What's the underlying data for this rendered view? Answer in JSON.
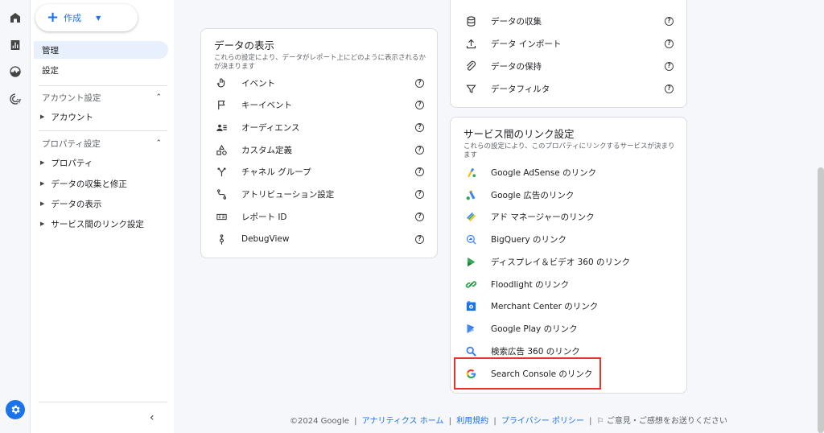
{
  "nav": {
    "create_label": "作成",
    "items": [
      {
        "label": "管理",
        "active": true
      },
      {
        "label": "設定",
        "active": false
      }
    ],
    "account_section": "アカウント設定",
    "account_items": [
      "アカウント"
    ],
    "property_section": "プロパティ設定",
    "property_items": [
      "プロパティ",
      "データの収集と修正",
      "データの表示",
      "サービス間のリンク設定"
    ]
  },
  "data_display": {
    "title": "データの表示",
    "description": "これらの設定により、データがレポート上にどのように表示されるかが決まります",
    "rows": [
      {
        "label": "イベント",
        "icon": "touch-icon"
      },
      {
        "label": "キーイベント",
        "icon": "flag-icon"
      },
      {
        "label": "オーディエンス",
        "icon": "audience-icon"
      },
      {
        "label": "カスタム定義",
        "icon": "shapes-icon"
      },
      {
        "label": "チャネル グループ",
        "icon": "merge-icon"
      },
      {
        "label": "アトリビューション設定",
        "icon": "route-icon"
      },
      {
        "label": "レポート ID",
        "icon": "report-id-icon"
      },
      {
        "label": "DebugView",
        "icon": "debug-icon"
      }
    ]
  },
  "data_collection": {
    "rows": [
      {
        "label": "データの収集",
        "icon": "database-icon"
      },
      {
        "label": "データ インポート",
        "icon": "upload-icon"
      },
      {
        "label": "データの保持",
        "icon": "retention-icon"
      },
      {
        "label": "データフィルタ",
        "icon": "filter-icon"
      }
    ]
  },
  "links": {
    "title": "サービス間のリンク設定",
    "description": "これらの設定により、このプロパティにリンクするサービスが決まります",
    "rows": [
      {
        "label": "Google AdSense のリンク",
        "icon": "adsense-icon"
      },
      {
        "label": "Google 広告のリンク",
        "icon": "google-ads-icon"
      },
      {
        "label": "アド マネージャーのリンク",
        "icon": "ad-manager-icon"
      },
      {
        "label": "BigQuery のリンク",
        "icon": "bigquery-icon"
      },
      {
        "label": "ディスプレイ＆ビデオ 360 のリンク",
        "icon": "dv360-icon"
      },
      {
        "label": "Floodlight のリンク",
        "icon": "floodlight-icon"
      },
      {
        "label": "Merchant Center のリンク",
        "icon": "merchant-center-icon"
      },
      {
        "label": "Google Play のリンク",
        "icon": "google-play-icon"
      },
      {
        "label": "検索広告 360 のリンク",
        "icon": "sa360-icon"
      },
      {
        "label": "Search Console のリンク",
        "icon": "google-g-icon"
      }
    ]
  },
  "footer": {
    "copyright": "©2024 Google",
    "analytics_home": "アナリティクス ホーム",
    "terms": "利用規約",
    "privacy": "プライバシー ポリシー",
    "feedback": "ご意見・ご感想をお送りください"
  },
  "colors": {
    "accent": "#1a73e8",
    "highlight": "#e8322e",
    "active_nav": "#e8f0fe"
  }
}
